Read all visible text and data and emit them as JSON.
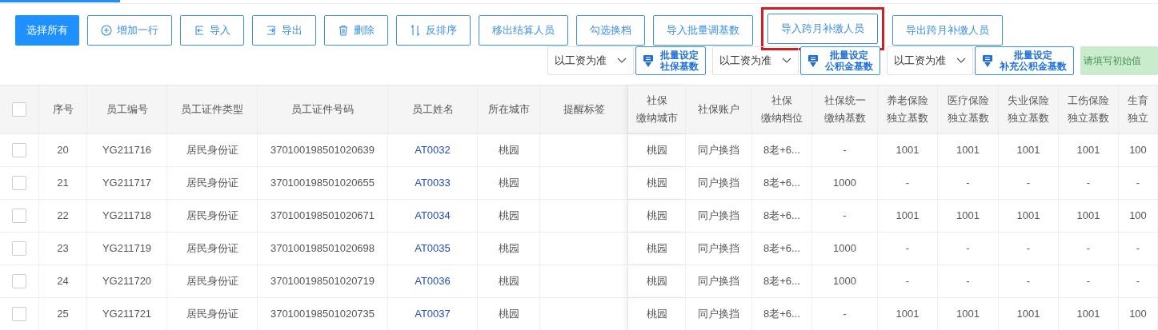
{
  "tabs": [
    {
      "selected": true
    }
  ],
  "toolbar": [
    {
      "label": "选择所有",
      "kind": "primary",
      "highlighted": false
    },
    {
      "label": "增加一行",
      "kind": "add",
      "highlighted": false
    },
    {
      "label": "导入",
      "kind": "import",
      "highlighted": false
    },
    {
      "label": "导出",
      "kind": "export",
      "highlighted": false
    },
    {
      "label": "删除",
      "kind": "delete",
      "highlighted": false
    },
    {
      "label": "反排序",
      "kind": "sort",
      "highlighted": false
    },
    {
      "label": "移出结算人员",
      "kind": "plain",
      "highlighted": false
    },
    {
      "label": "勾选换档",
      "kind": "plain",
      "highlighted": false
    },
    {
      "label": "导入批量调基数",
      "kind": "plain",
      "highlighted": false
    },
    {
      "label": "导入跨月补缴人员",
      "kind": "plain",
      "highlighted": true
    },
    {
      "label": "导出跨月补缴人员",
      "kind": "plain",
      "highlighted": false
    }
  ],
  "batch_settings": [
    {
      "select": "以工资为准",
      "line1": "批量设定",
      "line2": "社保基数"
    },
    {
      "select": "以工资为准",
      "line1": "批量设定",
      "line2": "公积金基数"
    },
    {
      "select": "以工资为准",
      "line1": "批量设定",
      "line2": "补充公积金基数"
    }
  ],
  "initial_button": {
    "label": "请填写初始值",
    "disabled": true
  },
  "table": {
    "header_checkbox": {
      "checked": false
    },
    "columns": [
      {
        "kind": "text",
        "lines": [
          "序号"
        ]
      },
      {
        "kind": "text",
        "lines": [
          "员工编号"
        ]
      },
      {
        "kind": "text",
        "lines": [
          "员工证件类型"
        ]
      },
      {
        "kind": "text",
        "lines": [
          "员工证件号码"
        ]
      },
      {
        "kind": "link",
        "lines": [
          "员工姓名"
        ]
      },
      {
        "kind": "text",
        "lines": [
          "所在城市"
        ]
      },
      {
        "lines": [
          "提醒标签"
        ]
      },
      {
        "kind": "text",
        "lines": [
          "社保",
          "缴纳城市"
        ]
      },
      {
        "kind": "text",
        "lines": [
          "社保账户"
        ]
      },
      {
        "kind": "text",
        "lines": [
          "社保",
          "缴纳档位"
        ]
      },
      {
        "kind": "text",
        "lines": [
          "社保统一",
          "缴纳基数"
        ]
      },
      {
        "kind": "text",
        "lines": [
          "养老保险",
          "独立基数"
        ]
      },
      {
        "kind": "text",
        "lines": [
          "医疗保险",
          "独立基数"
        ]
      },
      {
        "kind": "text",
        "lines": [
          "失业保险",
          "独立基数"
        ]
      },
      {
        "kind": "text",
        "lines": [
          "工伤保险",
          "独立基数"
        ]
      },
      {
        "kind": "text",
        "lines": [
          "生育",
          "独立"
        ]
      }
    ],
    "rows": [
      {
        "checked": false,
        "cells": [
          "20",
          "YG211716",
          "居民身份证",
          "370100198501020639",
          "AT0032",
          "桃园",
          null,
          "桃园",
          "同户换挡",
          "8老+6...",
          "-",
          "1001",
          "1001",
          "1001",
          "1001",
          "100"
        ]
      },
      {
        "checked": false,
        "cells": [
          "21",
          "YG211717",
          "居民身份证",
          "370100198501020655",
          "AT0033",
          "桃园",
          null,
          "桃园",
          "同户换挡",
          "8老+6...",
          "1000",
          "-",
          "-",
          "-",
          "-",
          "-"
        ]
      },
      {
        "checked": false,
        "cells": [
          "22",
          "YG211718",
          "居民身份证",
          "370100198501020671",
          "AT0034",
          "桃园",
          null,
          "桃园",
          "同户换挡",
          "8老+6...",
          "-",
          "1001",
          "1001",
          "1001",
          "1001",
          "100"
        ]
      },
      {
        "checked": false,
        "cells": [
          "23",
          "YG211719",
          "居民身份证",
          "370100198501020698",
          "AT0035",
          "桃园",
          null,
          "桃园",
          "同户换挡",
          "8老+6...",
          "1000",
          "-",
          "-",
          "-",
          "-",
          "-"
        ]
      },
      {
        "checked": false,
        "cells": [
          "24",
          "YG211720",
          "居民身份证",
          "370100198501020719",
          "AT0036",
          "桃园",
          null,
          "桃园",
          "同户换挡",
          "8老+6...",
          "1000",
          "-",
          "-",
          "-",
          "-",
          "-"
        ]
      },
      {
        "checked": false,
        "cells": [
          "25",
          "YG211721",
          "居民身份证",
          "370100198501020735",
          "AT0037",
          "桃园",
          null,
          "桃园",
          "同户换挡",
          "8老+6...",
          "-",
          "1001",
          "1001",
          "1001",
          "1001",
          "100"
        ]
      }
    ]
  }
}
